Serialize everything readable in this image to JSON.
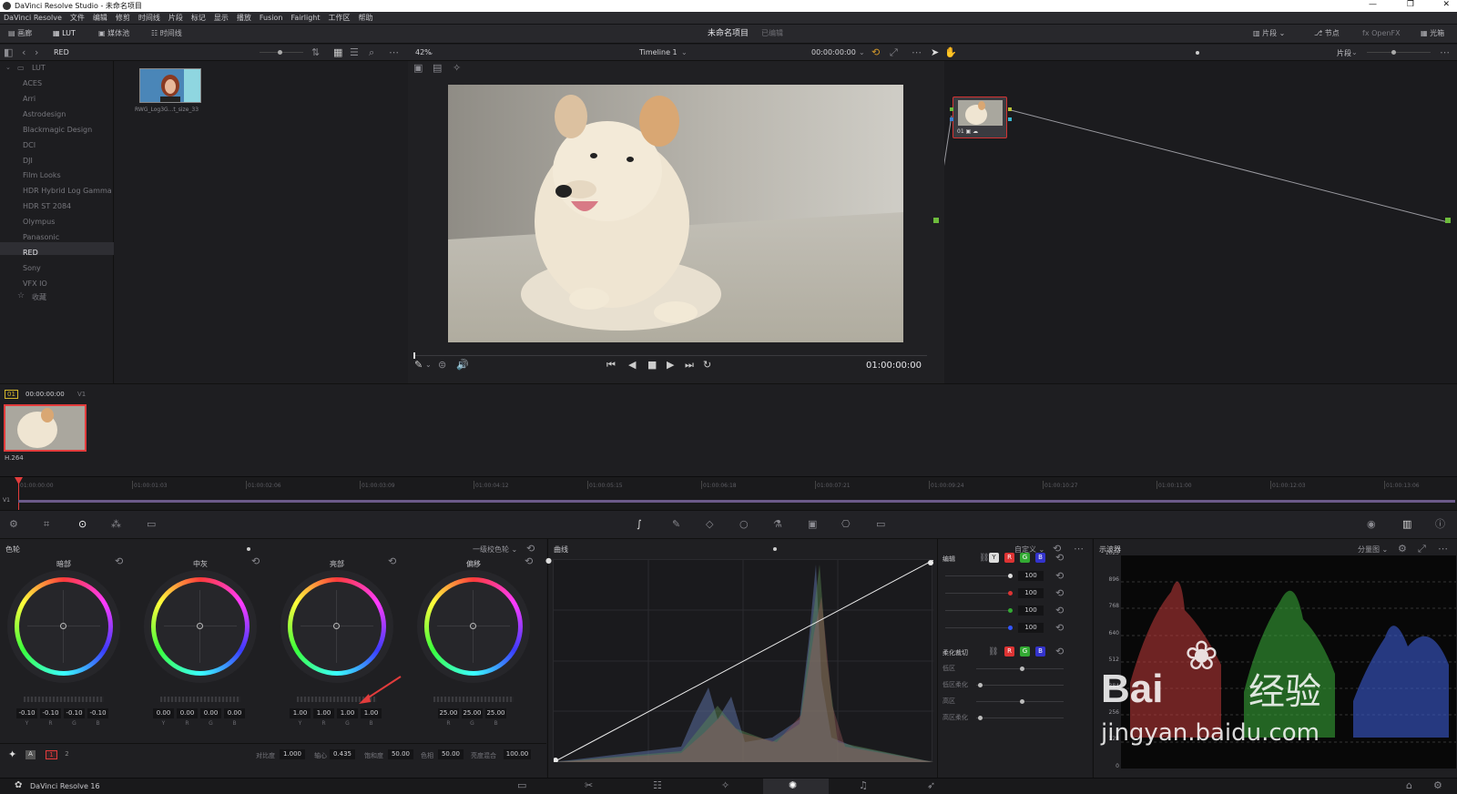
{
  "window": {
    "title": "DaVinci Resolve Studio - 未命名项目"
  },
  "menu": [
    "DaVinci Resolve",
    "文件",
    "编辑",
    "修剪",
    "时间线",
    "片段",
    "标记",
    "显示",
    "播放",
    "Fusion",
    "Fairlight",
    "工作区",
    "帮助"
  ],
  "toolbar": {
    "gallery": "画廊",
    "lut": "LUT",
    "media_pool": "媒体池",
    "timeline": "时间线",
    "project": "未命名项目",
    "edited": "已编辑",
    "clips": "片段",
    "nodes": "节点",
    "openfx": "OpenFX",
    "lightbox": "光箱"
  },
  "lut_panel": {
    "current": "RED",
    "root": "LUT",
    "folders": [
      "ACES",
      "Arri",
      "Astrodesign",
      "Blackmagic Design",
      "DCI",
      "DJI",
      "Film Looks",
      "HDR Hybrid Log Gamma",
      "HDR ST 2084",
      "Olympus",
      "Panasonic",
      "RED",
      "Sony",
      "VFX IO"
    ],
    "favorites": "收藏",
    "thumb_label": "RWG_Log3G...t_size_33"
  },
  "viewer": {
    "zoom": "42%",
    "timeline_name": "Timeline 1",
    "timecode_top": "00:00:00:00",
    "timecode": "01:00:00:00",
    "clip_mode": "片段"
  },
  "clips": {
    "index": "01",
    "timecode": "00:00:00:00",
    "track": "V1",
    "codec": "H.264"
  },
  "timeline_ruler": [
    "01:00:00:00",
    "01:00:01:03",
    "01:00:02:06",
    "01:00:03:09",
    "01:00:04:12",
    "01:00:05:15",
    "01:00:06:18",
    "01:00:07:21",
    "01:00:09:24",
    "01:00:10:27",
    "01:00:11:00",
    "01:00:12:03",
    "01:00:13:06"
  ],
  "timeline_track": "V1",
  "color_wheels": {
    "title": "色轮",
    "mode": "一级校色轮",
    "wheels": [
      {
        "name": "暗部",
        "values": [
          "-0.10",
          "-0.10",
          "-0.10",
          "-0.10"
        ],
        "labels": [
          "Y",
          "R",
          "G",
          "B"
        ]
      },
      {
        "name": "中灰",
        "values": [
          "0.00",
          "0.00",
          "0.00",
          "0.00"
        ],
        "labels": [
          "Y",
          "R",
          "G",
          "B"
        ]
      },
      {
        "name": "亮部",
        "values": [
          "1.00",
          "1.00",
          "1.00",
          "1.00"
        ],
        "labels": [
          "Y",
          "R",
          "G",
          "B"
        ]
      },
      {
        "name": "偏移",
        "values": [
          "25.00",
          "25.00",
          "25.00"
        ],
        "labels": [
          "R",
          "G",
          "B"
        ]
      }
    ],
    "footer": {
      "page1": "1",
      "page2": "2",
      "contrast_label": "对比度",
      "contrast": "1.000",
      "pivot_label": "轴心",
      "pivot": "0.435",
      "saturation_label": "饱和度",
      "saturation": "50.00",
      "hue_label": "色相",
      "hue": "50.00",
      "lum_mix_label": "亮度混合",
      "lum_mix": "100.00"
    }
  },
  "curves": {
    "title": "曲线",
    "mode": "自定义",
    "edit_label": "编辑",
    "channels": [
      "Y",
      "R",
      "G",
      "B"
    ],
    "intensity": [
      "100",
      "100",
      "100",
      "100"
    ],
    "soft_clip_label": "柔化裁切",
    "soft_rows": [
      "低区",
      "低区柔化",
      "高区",
      "高区柔化"
    ]
  },
  "scopes": {
    "title": "示波器",
    "mode": "分量图",
    "scale": [
      "1023",
      "896",
      "768",
      "640",
      "512",
      "384",
      "256",
      "128",
      "0"
    ],
    "watermark_main": "Bai",
    "watermark_cn": "经验",
    "watermark_url": "jingyan.baidu.com"
  },
  "footer": {
    "app": "DaVinci Resolve 16"
  },
  "colors": {
    "accent_red": "#e23c3c",
    "playhead": "#e23c3c",
    "node_border": "#d43333"
  }
}
